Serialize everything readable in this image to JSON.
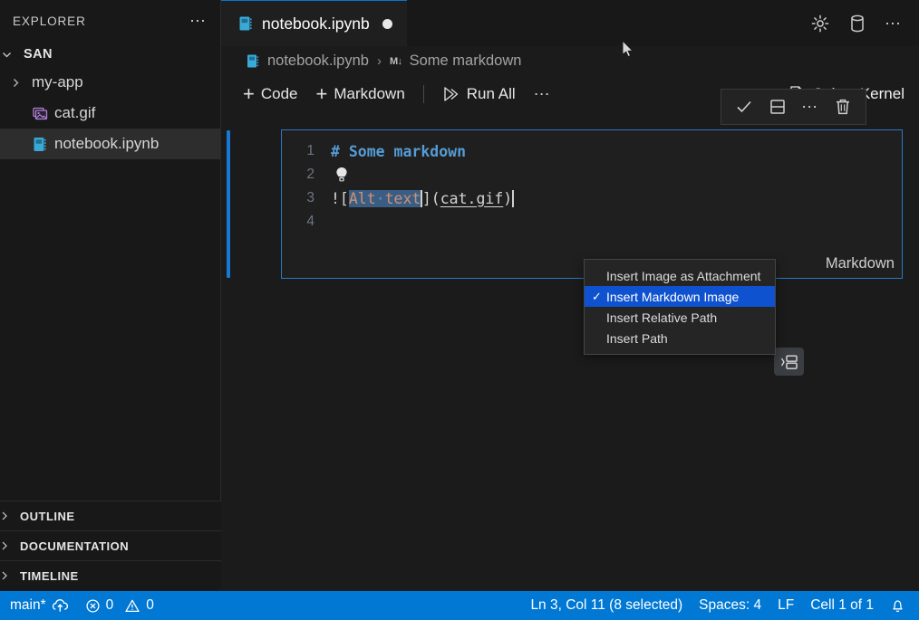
{
  "sidebar": {
    "header": {
      "title": "EXPLORER",
      "more_icon": "ellipsis-icon"
    },
    "root": {
      "label": "SAN",
      "expanded": true
    },
    "items": [
      {
        "label": "my-app",
        "icon": "folder-chevron-icon",
        "type": "folder",
        "selected": false
      },
      {
        "label": "cat.gif",
        "icon": "image-file-icon",
        "type": "file",
        "selected": false
      },
      {
        "label": "notebook.ipynb",
        "icon": "notebook-file-icon",
        "type": "file",
        "selected": true
      }
    ],
    "panels": [
      {
        "label": "OUTLINE"
      },
      {
        "label": "DOCUMENTATION"
      },
      {
        "label": "TIMELINE"
      }
    ]
  },
  "editor": {
    "tab": {
      "label": "notebook.ipynb",
      "icon": "notebook-file-icon",
      "dirty": true
    },
    "tab_actions": [
      {
        "name": "settings-gear-icon",
        "label": "Settings"
      },
      {
        "name": "kernel-database-icon",
        "label": "Kernel"
      },
      {
        "name": "more-actions-icon",
        "label": "More Actions"
      }
    ],
    "breadcrumb": {
      "file": "notebook.ipynb",
      "separator": "›",
      "symbol_glyph": "M↓",
      "symbol": "Some markdown"
    },
    "toolbar": {
      "code_label": "Code",
      "markdown_label": "Markdown",
      "run_all_label": "Run All",
      "more_label": "···",
      "select_kernel_label": "Select Kernel"
    }
  },
  "cell": {
    "kind_label": "Markdown",
    "lines": [
      {
        "number": "1",
        "kind": "heading",
        "text": "# Some markdown"
      },
      {
        "number": "2",
        "kind": "bulb",
        "text": ""
      },
      {
        "number": "3",
        "kind": "image-link",
        "prefix": "![",
        "selected_text": "Alt text",
        "middle": "](",
        "link": "cat.gif",
        "suffix": ")"
      },
      {
        "number": "4",
        "kind": "empty",
        "text": ""
      }
    ],
    "toolbar": [
      {
        "name": "confirm-check-icon",
        "label": "Confirm"
      },
      {
        "name": "split-cell-icon",
        "label": "Split Cell"
      },
      {
        "name": "more-actions-icon",
        "label": "More"
      },
      {
        "name": "delete-trash-icon",
        "label": "Delete Cell"
      }
    ],
    "widget_icon": "insert-options-icon"
  },
  "context_menu": {
    "items": [
      {
        "label": "Insert Image as Attachment",
        "checked": false,
        "active": false
      },
      {
        "label": "Insert Markdown Image",
        "checked": true,
        "active": true
      },
      {
        "label": "Insert Relative Path",
        "checked": false,
        "active": false
      },
      {
        "label": "Insert Path",
        "checked": false,
        "active": false
      }
    ]
  },
  "statusbar": {
    "branch": "main*",
    "sync_icon": "sync-cloud-icon",
    "errors": "0",
    "warnings": "0",
    "position": "Ln 3, Col 11 (8 selected)",
    "spaces": "Spaces: 4",
    "eol": "LF",
    "cell_count": "Cell 1 of 1",
    "bell_icon": "notification-bell-icon",
    "background": "#0078d4"
  }
}
